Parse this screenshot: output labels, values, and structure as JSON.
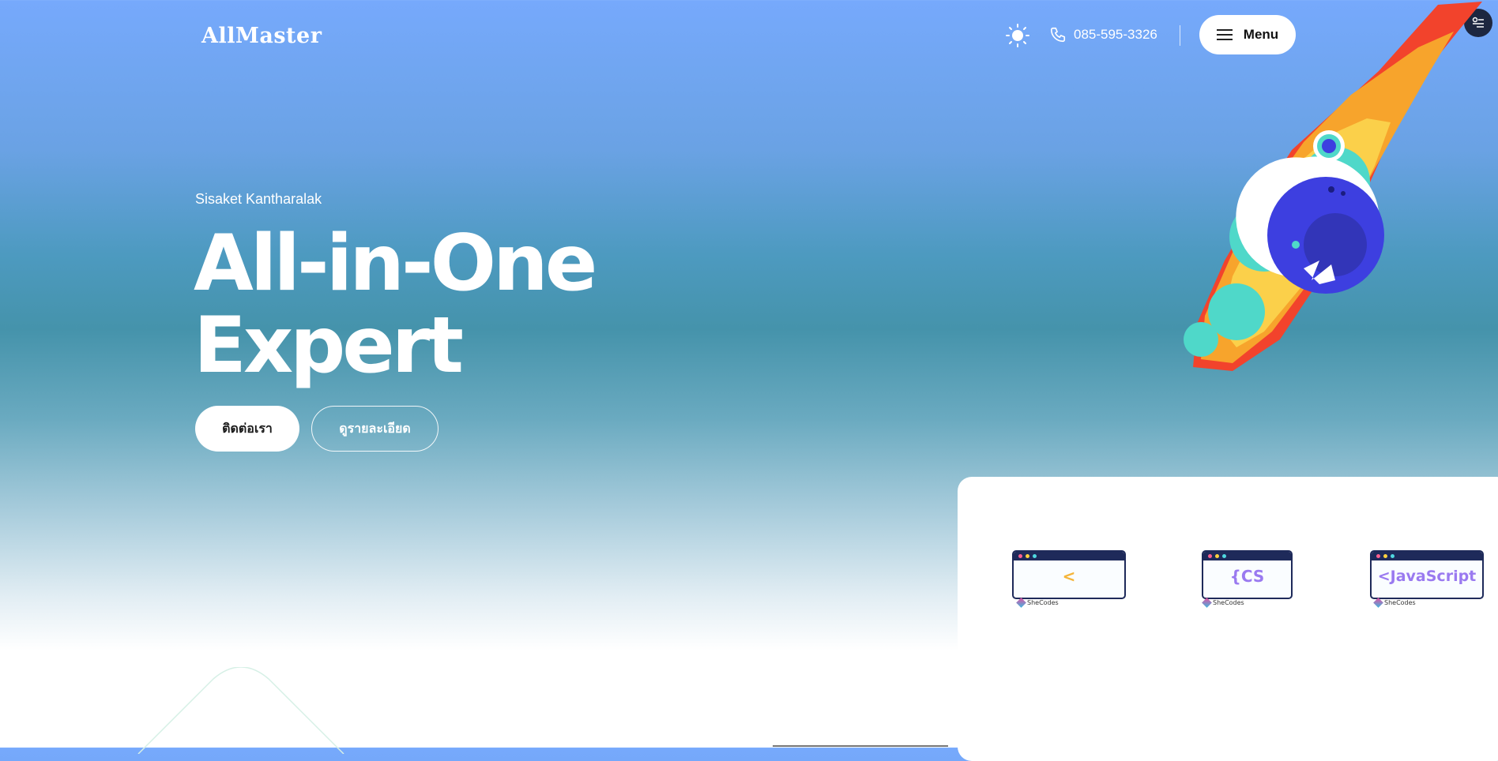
{
  "header": {
    "logo": "AllMaster",
    "theme_icon": "sun-icon",
    "phone_icon": "phone-icon",
    "phone": "085-595-3326",
    "menu_label": "Menu",
    "menu_icon": "hamburger-icon",
    "floating_icon": "settings-icon"
  },
  "hero": {
    "subtitle": "Sisaket Kantharalak",
    "title_line1": "All-in-One",
    "title_line2": "Expert",
    "primary_button": "ติดต่อเรา",
    "secondary_button": "ดูรายละเอียด"
  },
  "showcase": {
    "tiles": [
      {
        "code": "<",
        "brand": "SheCodes"
      },
      {
        "code": "{CS",
        "brand": "SheCodes"
      },
      {
        "code": "<JavaScript",
        "brand": "SheCodes"
      }
    ]
  },
  "colors": {
    "accent_dark": "#1d2740",
    "meteor_blue": "#3d3fe0",
    "meteor_teal": "#4fd8c9",
    "flame_orange": "#f7a42c",
    "flame_red": "#f2432c"
  }
}
